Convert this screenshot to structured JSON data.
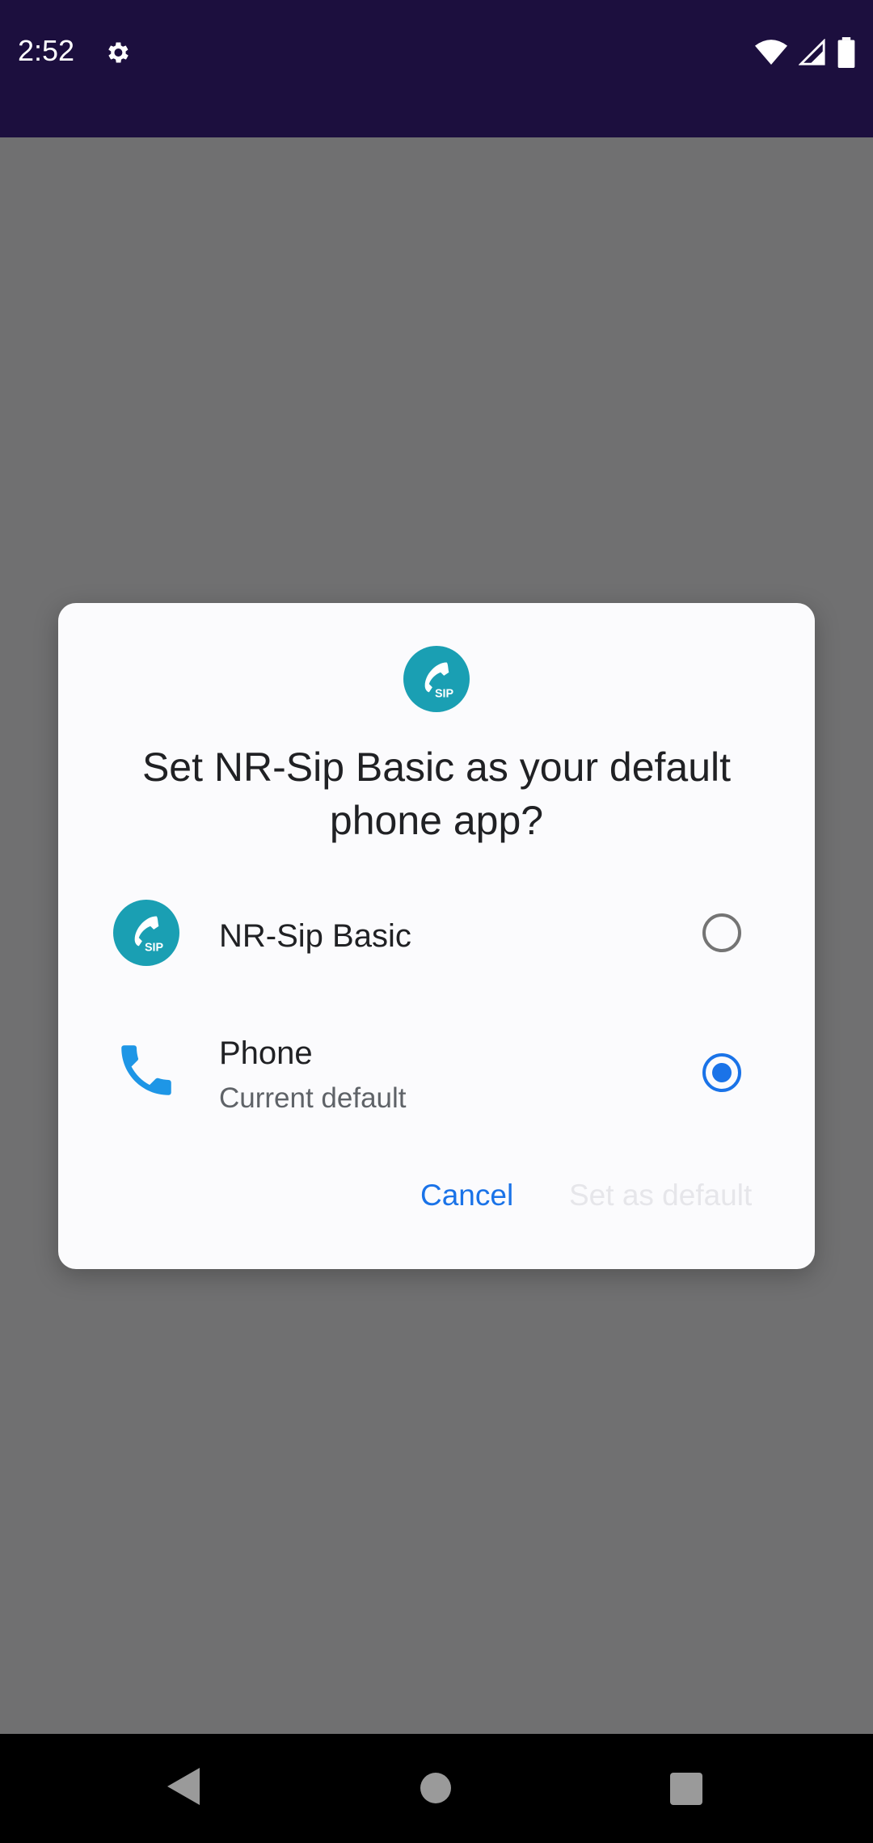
{
  "status_bar": {
    "time": "2:52",
    "icons": [
      "gear-icon",
      "wifi-icon",
      "signal-icon",
      "battery-icon"
    ]
  },
  "dialog": {
    "title": "Set NR-Sip Basic as your default phone app?",
    "app_icon": "sip-phone-app-icon",
    "options": [
      {
        "label": "NR-Sip Basic",
        "subtitle": "",
        "icon": "sip-phone-app-icon",
        "selected": false
      },
      {
        "label": "Phone",
        "subtitle": "Current default",
        "icon": "phone-handset-icon",
        "selected": true
      }
    ],
    "buttons": {
      "cancel": "Cancel",
      "set_default": "Set as default"
    }
  },
  "nav_bar": {
    "icons": [
      "back-icon",
      "home-icon",
      "recents-icon"
    ]
  },
  "colors": {
    "status_bar": "#1c0f3e",
    "scrim": "#707071",
    "dialog_bg": "#fbfbfd",
    "accent": "#1a73e8",
    "app_icon_teal": "#1a9fb3",
    "phone_icon_blue": "#1e96e6"
  }
}
